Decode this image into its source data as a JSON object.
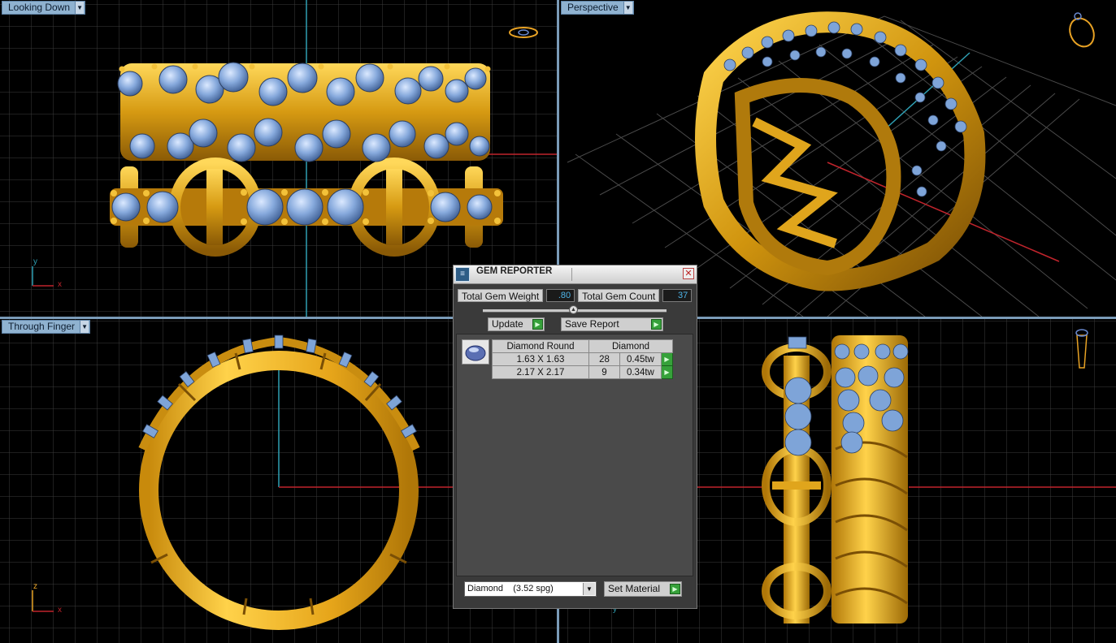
{
  "viewports": {
    "top_left": {
      "label": "Looking Down",
      "axes": [
        "y",
        "x"
      ]
    },
    "top_right": {
      "label": "Perspective"
    },
    "bottom_left": {
      "label": "Through Finger",
      "axes": [
        "z",
        "x"
      ]
    },
    "bottom_right": {
      "axes": [
        "y"
      ]
    }
  },
  "dialog": {
    "title": "GEM REPORTER",
    "close_glyph": "✕",
    "total_weight_label": "Total Gem Weight",
    "total_weight_value": ".80",
    "total_count_label": "Total Gem Count",
    "total_count_value": "37",
    "update_label": "Update",
    "save_report_label": "Save Report",
    "table_header": {
      "shape": "Diamond Round",
      "material": "Diamond"
    },
    "rows": [
      {
        "size": "1.63 X 1.63",
        "count": "28",
        "weight": "0.45tw"
      },
      {
        "size": "2.17 X 2.17",
        "count": "9",
        "weight": "0.34tw"
      }
    ],
    "material_option": "Diamond    (3.52 spg)",
    "set_material_label": "Set Material"
  },
  "colors": {
    "gold": "#e0a51c",
    "gem": "#7ea4d8",
    "grid": "#3e3e3e",
    "grid_major_red": "#c0242c",
    "grid_major_cyan": "#2fa0b4",
    "label_bg": "#8fb2d0"
  }
}
